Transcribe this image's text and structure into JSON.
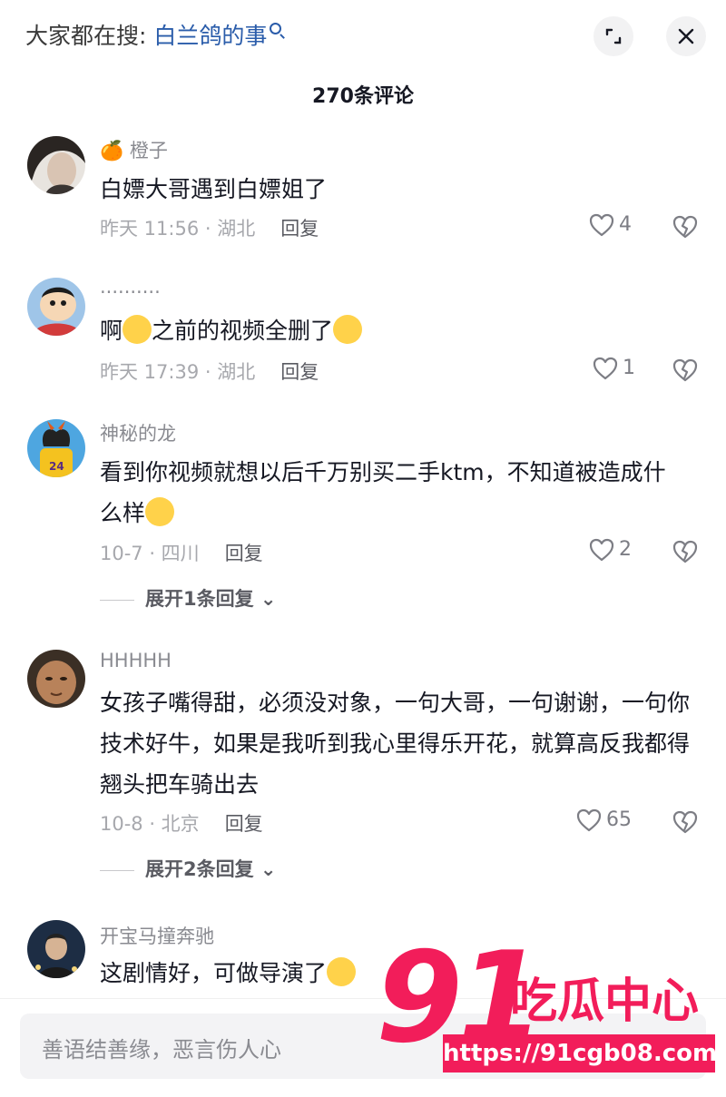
{
  "header": {
    "search_prefix": "大家都在搜: ",
    "search_keyword": "白兰鸽的事",
    "comment_count_title": "270条评论"
  },
  "comments": [
    {
      "username": "🍊 橙子",
      "text": "白嫖大哥遇到白嫖姐了",
      "meta": "昨天 11:56 · 湖北",
      "reply_label": "回复",
      "likes": "4"
    },
    {
      "username": "··········",
      "text_a": "啊",
      "text_b": "之前的视频全删了",
      "meta": "昨天 17:39 · 湖北",
      "reply_label": "回复",
      "likes": "1"
    },
    {
      "username": "神秘的龙",
      "text_a": "看到你视频就想以后千万别买二手ktm，不知道被造成什",
      "text_b": "么样",
      "meta": "10-7 · 四川",
      "reply_label": "回复",
      "likes": "2",
      "expand_label": "展开1条回复 ⌄"
    },
    {
      "username": "HHHHH",
      "text": "女孩子嘴得甜，必须没对象，一句大哥，一句谢谢，一句你技术好牛，如果是我听到我心里得乐开花，就算高反我都得翘头把车骑出去",
      "meta": "10-8 · 北京",
      "reply_label": "回复",
      "likes": "65",
      "expand_label": "展开2条回复 ⌄"
    },
    {
      "username": "开宝马撞奔驰",
      "text": "这剧情好，可做导演了"
    }
  ],
  "input": {
    "placeholder": "善语结善缘，恶言伤人心"
  },
  "watermark": {
    "number": "91",
    "brand": "吃瓜中心",
    "url": "https://91cgb08.com"
  },
  "colors": {
    "keyword": "#2a5caa",
    "watermark": "#f21d5a",
    "emoji": "#ffd24a"
  }
}
